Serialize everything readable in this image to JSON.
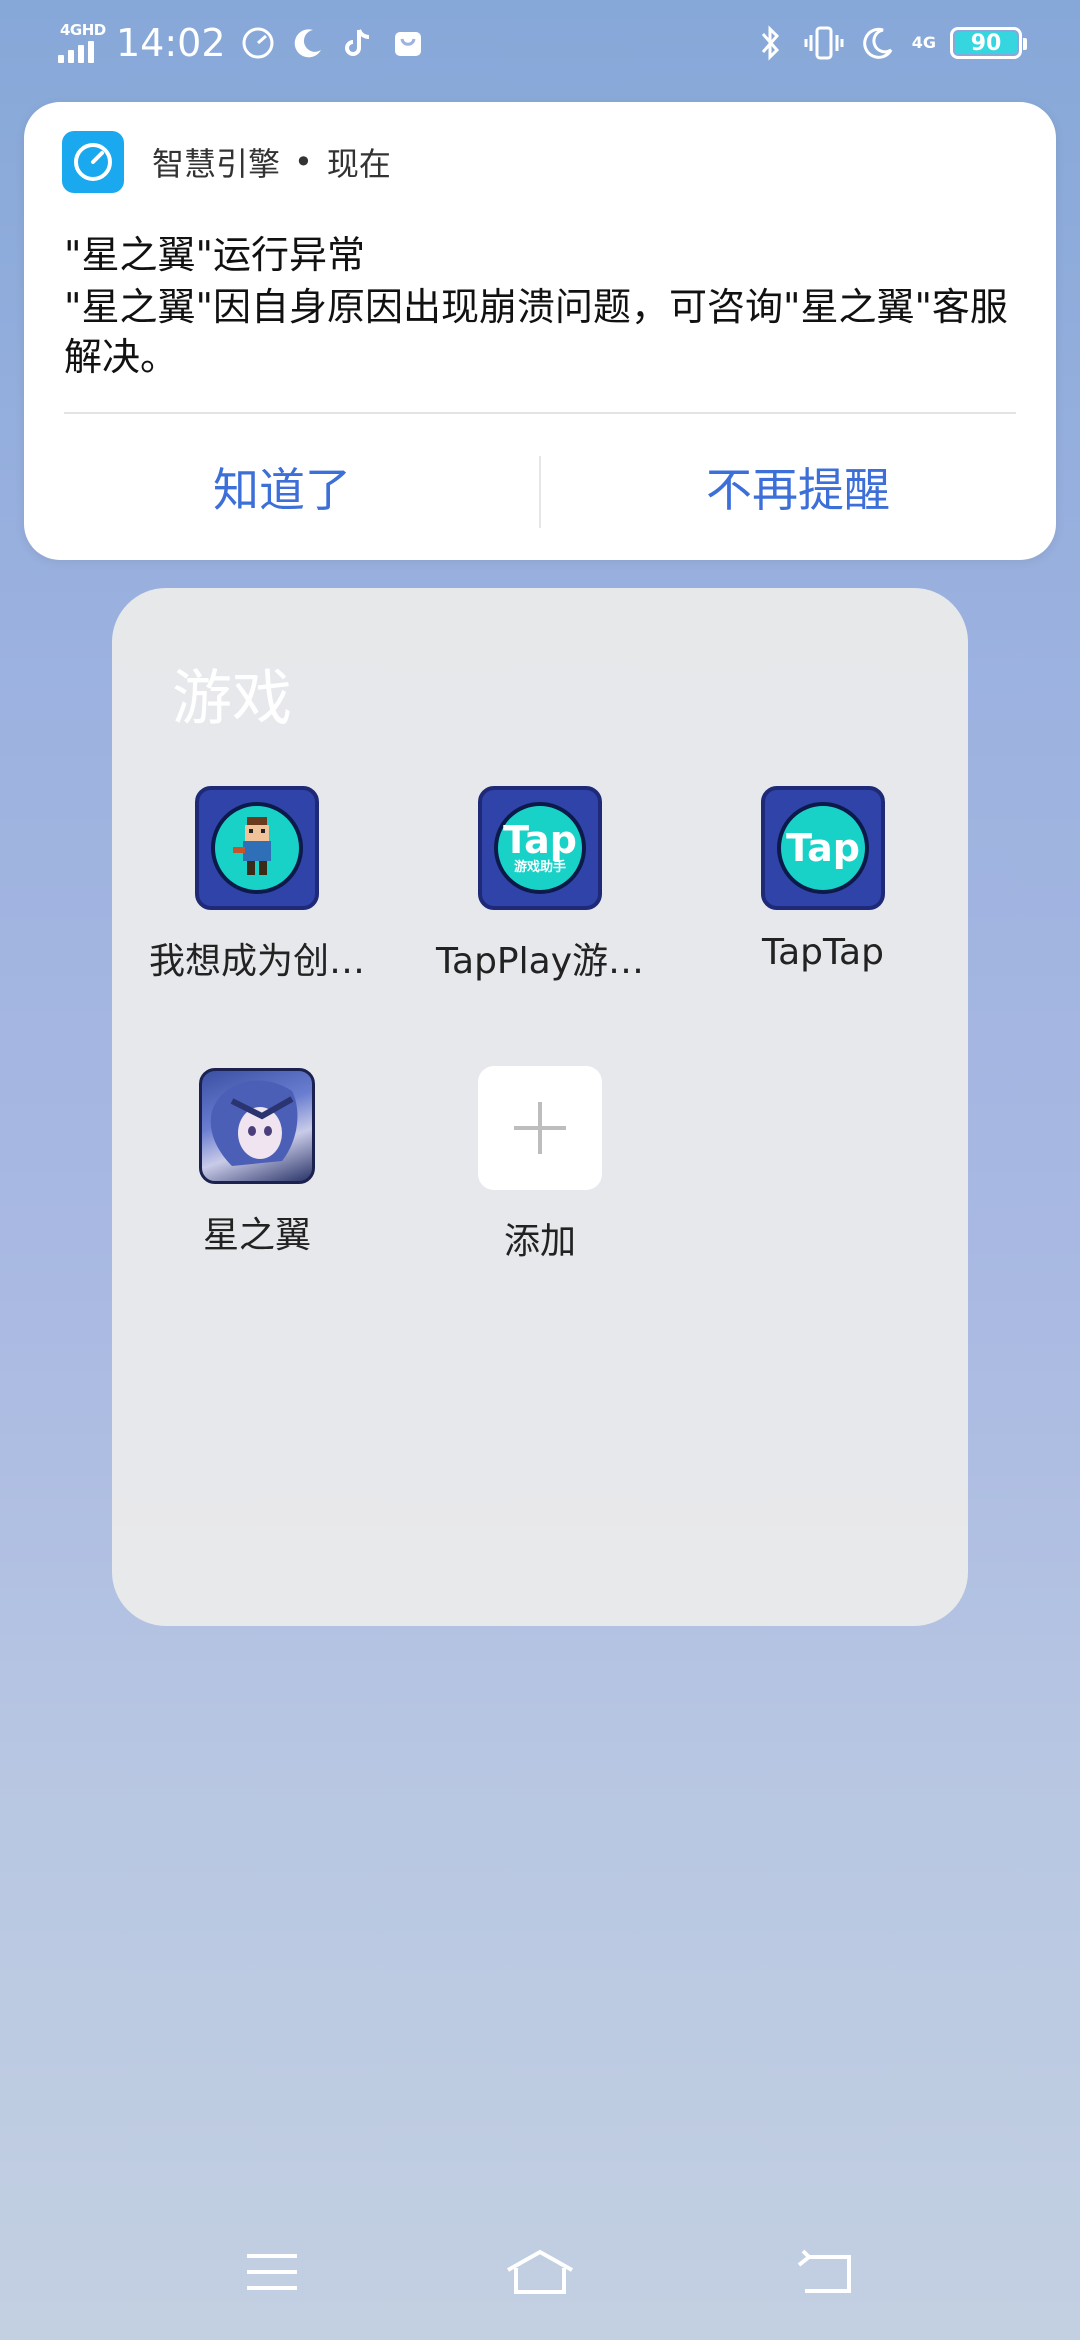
{
  "status_bar": {
    "network_label": "4GHD",
    "time": "14:02",
    "battery_level": "90",
    "network_right": "4G"
  },
  "notification": {
    "app_name": "智慧引擎",
    "separator": "•",
    "time": "现在",
    "title": "\"星之翼\"运行异常",
    "body": "\"星之翼\"因自身原因出现崩溃问题，可咨询\"星之翼\"客服解决。",
    "action_ok": "知道了",
    "action_mute": "不再提醒"
  },
  "folder": {
    "title": "游戏",
    "apps": [
      {
        "label": "我想成为创…",
        "icon": "pixel-hero-game-icon"
      },
      {
        "label": "TapPlay游…",
        "icon": "tap-assistant-icon"
      },
      {
        "label": "TapTap",
        "icon": "taptap-icon"
      },
      {
        "label": "星之翼",
        "icon": "anime-character-icon"
      },
      {
        "label": "添加",
        "icon": "plus-icon"
      }
    ],
    "tap_logo": "Tap",
    "tap_sub": "游戏助手"
  },
  "colors": {
    "accent": "#3c6fd8",
    "app_icon_blue": "#1aa8ee",
    "tap_teal": "#18d2c8",
    "battery": "#36d6e0"
  }
}
